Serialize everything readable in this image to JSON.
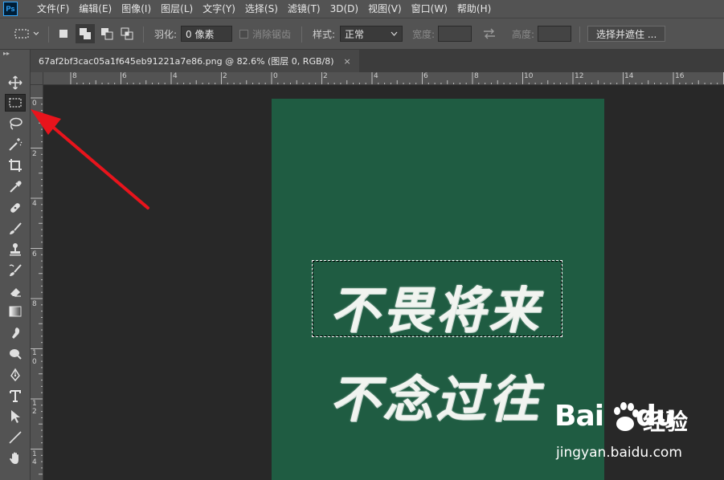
{
  "app": {
    "logo_text": "Ps"
  },
  "menu": [
    "文件(F)",
    "编辑(E)",
    "图像(I)",
    "图层(L)",
    "文字(Y)",
    "选择(S)",
    "滤镜(T)",
    "3D(D)",
    "视图(V)",
    "窗口(W)",
    "帮助(H)"
  ],
  "options": {
    "feather_label": "羽化:",
    "feather_value": "0 像素",
    "antialias_label": "消除锯齿",
    "style_label": "样式:",
    "style_value": "正常",
    "width_label": "宽度:",
    "height_label": "高度:",
    "select_mask_button": "选择并遮住 ..."
  },
  "document": {
    "tab_title": "67af2bf3cac05a1f645eb91221a7e86.png @ 82.6% (图层 0, RGB/8)",
    "close_glyph": "×",
    "canvas_line1": "不畏将来",
    "canvas_line2": "不念过往"
  },
  "ruler_h_labels": [
    "8",
    "6",
    "4",
    "2",
    "0",
    "2",
    "4",
    "6",
    "8",
    "10",
    "12",
    "14",
    "16"
  ],
  "ruler_v_labels": [
    "0",
    "2",
    "4",
    "6",
    "8",
    "1",
    "0",
    "1",
    "2",
    "1",
    "4"
  ],
  "tools": [
    "move-tool",
    "rectangular-marquee-tool",
    "lasso-tool",
    "magic-wand-tool",
    "crop-tool",
    "eyedropper-tool",
    "healing-brush-tool",
    "brush-tool",
    "clone-stamp-tool",
    "history-brush-tool",
    "eraser-tool",
    "gradient-tool",
    "blur-tool",
    "dodge-tool",
    "pen-tool",
    "type-tool",
    "path-selection-tool",
    "line-tool",
    "hand-tool"
  ],
  "watermark": {
    "brand": "Bai",
    "brand_tail": "du",
    "cn": "经验",
    "url": "jingyan.baidu.com"
  },
  "colors": {
    "chrome": "#535353",
    "workspace": "#282828",
    "artboard": "#1f5c42",
    "arrow": "#e8141c",
    "accent": "#31a8ff"
  }
}
